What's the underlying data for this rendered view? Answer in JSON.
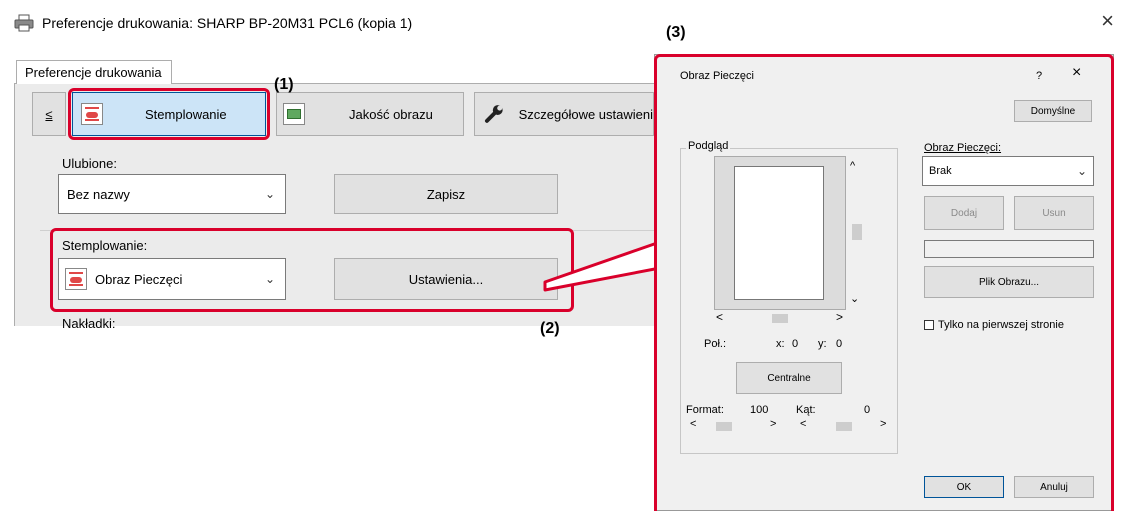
{
  "window": {
    "title": "Preferencje drukowania: SHARP BP-20M31 PCL6 (kopia 1)",
    "close_glyph": "×"
  },
  "tabs": [
    {
      "label": "Preferencje drukowania"
    }
  ],
  "toolbar": {
    "prev_glyph": "≤",
    "stamp_label": "Stemplowanie",
    "quality_label": "Jakość obrazu",
    "details_label": "Szczegółowe ustawieni"
  },
  "favorites": {
    "label": "Ulubione:",
    "value": "Bez nazwy",
    "save_label": "Zapisz"
  },
  "stamping": {
    "label": "Stemplowanie:",
    "value": "Obraz Pieczęci",
    "settings_label": "Ustawienia..."
  },
  "overlays": {
    "label": "Nakładki:"
  },
  "callouts": {
    "one": "(1)",
    "two": "(2)",
    "three": "(3)"
  },
  "dialog": {
    "title": "Obraz Pieczęci",
    "help_glyph": "?",
    "close_glyph": "×",
    "defaults_label": "Domyślne",
    "preview_label": "Podgląd",
    "position": {
      "label": "Poł.:",
      "x_label": "x:",
      "x_value": "0",
      "y_label": "y:",
      "y_value": "0"
    },
    "center_label": "Centralne",
    "format": {
      "label": "Format:",
      "value": "100"
    },
    "angle": {
      "label": "Kąt:",
      "value": "0"
    },
    "stamp_image_label": "Obraz Pieczęci:",
    "stamp_image_value": "Brak",
    "add_label": "Dodaj",
    "remove_label": "Usun",
    "image_file_label": "Plik Obrazu...",
    "first_page_label": "Tylko na pierwszej stronie",
    "ok_label": "OK",
    "cancel_label": "Anuluj"
  },
  "colors": {
    "accent": "#d9002b",
    "selected": "#cce4f7"
  }
}
